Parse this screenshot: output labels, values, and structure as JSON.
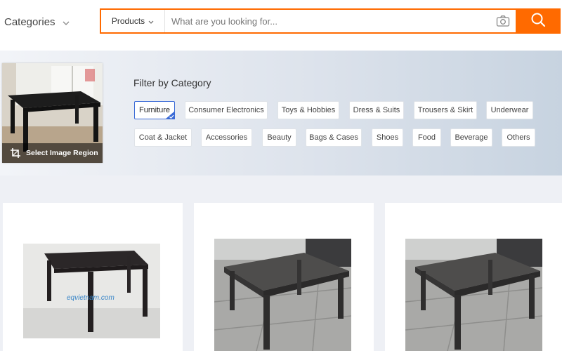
{
  "header": {
    "categories_label": "Categories",
    "search_scope": "Products",
    "search_placeholder": "What are you looking for..."
  },
  "image_search": {
    "region_label": "Select Image Region"
  },
  "filter": {
    "title": "Filter by Category",
    "selected": "Furniture",
    "chips": [
      "Furniture",
      "Consumer Electronics",
      "Toys & Hobbies",
      "Dress & Suits",
      "Trousers & Skirt",
      "Underwear",
      "Coat & Jacket",
      "Accessories",
      "Beauty",
      "Bags & Cases",
      "Shoes",
      "Food",
      "Beverage",
      "Others"
    ]
  },
  "products": [
    {
      "watermark": "eqvietnam.com"
    },
    {},
    {}
  ],
  "colors": {
    "accent": "#ff6a00",
    "selected_border": "#3b6bd6"
  }
}
